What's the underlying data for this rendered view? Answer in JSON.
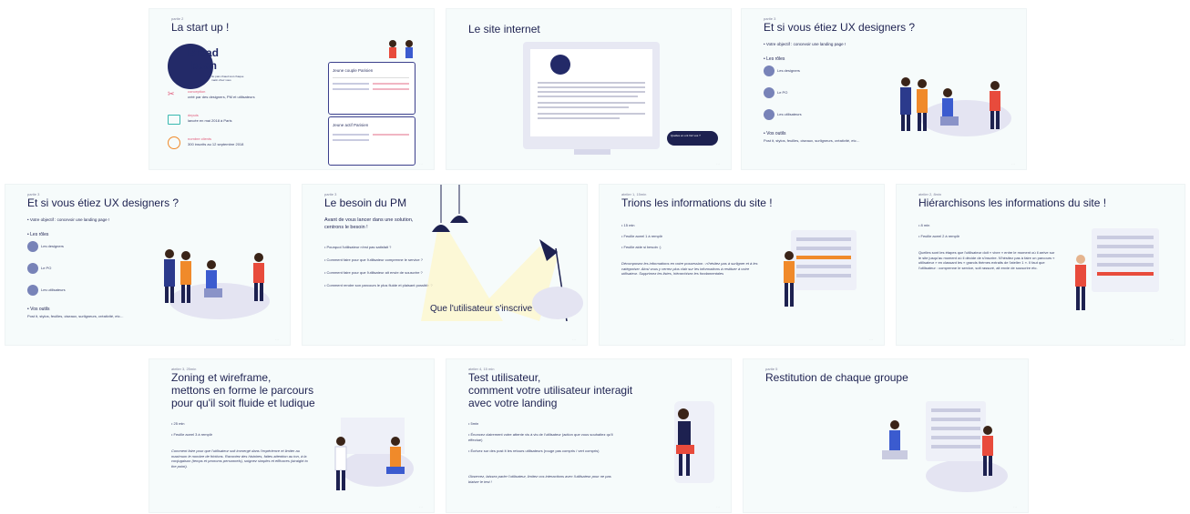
{
  "slides": {
    "s1": {
      "kicker": "partie 2",
      "title": "La start up !",
      "logo_line1": "Bread",
      "logo_line2": "bean",
      "tagline": "du pain chaud tout chaque matin chez vous",
      "items": [
        {
          "label": "conception",
          "value": "créé par des designers, PM et utilisateurs"
        },
        {
          "label": "depuis",
          "value": "lancée en mai 2018 à Paris"
        },
        {
          "label": "nombre clients",
          "value": "300 inscrits au 12 septembre 2018"
        }
      ],
      "persona1_title": "Jeune couple Parisien",
      "persona2_title": "Jeune actif Parisien"
    },
    "s2": {
      "title": "Le site internet",
      "callout": "Quelles en ont l'air vos ?"
    },
    "s3": {
      "kicker": "partie 3",
      "title": "Et si vous étiez UX designers ?",
      "goal": "• Votre objectif : concevoir une landing page !",
      "roles_title": "• Les rôles",
      "roles": [
        "Les designers",
        "Le PO",
        "Les utilisateurs"
      ],
      "tools_title": "• Vos outils",
      "tools": "Post it, stylos, feuilles, ciseaux, surligneurs, créativité, etc…"
    },
    "s4": {
      "kicker": "partie 3",
      "title": "Et si vous étiez UX designers ?",
      "goal": "• Votre objectif : concevoir une landing page !",
      "roles_title": "• Les rôles",
      "roles": [
        "Les designers",
        "Le PO",
        "Les utilisateurs"
      ],
      "tools_title": "• Vos outils",
      "tools": "Post it, stylos, feuilles, ciseaux, surligneurs, créativité, etc…"
    },
    "s5": {
      "kicker": "partie 3",
      "title": "Le besoin du PM",
      "intro1": "Avant de vous lancer dans une solution,",
      "intro2": "centrons le besoin !",
      "questions": [
        "• Pourquoi l'utilisateur n'est pas satisfait ?",
        "• Comment faire pour que l'utilisateur comprenne le service ?",
        "• Comment faire pour que l'utilisateur ait envie de souscrire ?",
        "• Comment rendre son parcours le plus fluide et plaisant possible ?"
      ],
      "answer": "Que l'utilisateur s'inscrive"
    },
    "s6": {
      "kicker": "atelier 1, 15min",
      "title": "Trions les informations du site !",
      "bullets": [
        "• 15 min",
        "• Feuille aceel 1 à remplir",
        "• Feuille aide si besoin :)"
      ],
      "note": "Décomposez les informations en votre possession : n'hésitez pas à surligner et à les catégoriser. Ainsi vous y verrez plus clair sur les informations à restituer à votre utilisateur. Supprimez les listes, hiérarchisez les fondamentales"
    },
    "s7": {
      "kicker": "atelier 2, 8min",
      "title": "Hiérarchisons les informations du site !",
      "bullets": [
        "• 8 min",
        "• Feuille aceel 2 à remplir"
      ],
      "note": "Quelles sont les étapes que l'utilisateur doit « vivre » entre le moment où il arrive sur le site jusqu'au moment où il décide de s'inscrire. N'hésitez pas à faire un parcours « utilisateur » en classant les « grands thèmes extraits de l'atelier 1 ». Il faut que l'utilisateur : comprenne le service, soit rassuré, ait envie de souscrire etc."
    },
    "s8": {
      "kicker": "atelier 3, 25min",
      "title_lines": [
        "Zoning et wireframe,",
        "mettons en forme le parcours",
        "pour qu'il soit fluide et ludique"
      ],
      "bullets": [
        "• 25 min",
        "• Feuille aceel 3 à remplir"
      ],
      "note": "Comment faire pour que l'utilisateur soit immergé dans l'expérience et limiter au maximum le nombre de frictions. Racontez des histoires, faites attention au ton, à la conjugaison (temps et pronoms personnels), soignez simples et efficaces (straight to the point)."
    },
    "s9": {
      "kicker": "atelier 4, 15 min",
      "title_lines": [
        "Test utilisateur,",
        "comment votre utilisateur interagit",
        "avec votre landing"
      ],
      "bullets": [
        "• 5min",
        "• Énoncez clairement votre attente vis à vis de l'utilisateur (action que vous souhaitez qu'il effectue)",
        "• Écrivez sur des post it les retours utilisateurs (rouge pas compris / vert compris)"
      ],
      "note": "Observez, laissez parler l'utilisateur, limitez vos interactions avec l'utilisateur pour ne pas biaiser le test !"
    },
    "s10": {
      "kicker": "partie 5",
      "title": "Restitution de chaque groupe"
    }
  },
  "colors": {
    "navy": "#1d2150",
    "blob": "#e4e4f2",
    "orange": "#f08a2a",
    "red": "#e84b3c",
    "purple": "#7883b8"
  }
}
